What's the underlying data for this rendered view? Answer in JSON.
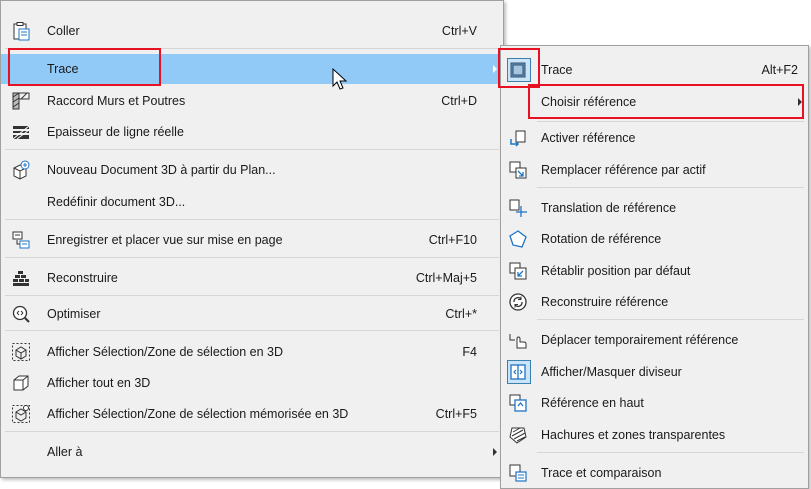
{
  "main_menu": {
    "items": [
      {
        "label": "Coller",
        "shortcut": "Ctrl+V",
        "icon": "clipboard-paste-icon"
      },
      {
        "label": "Trace",
        "shortcut": "",
        "icon": "",
        "submenu": true,
        "highlighted": true
      },
      {
        "label": "Raccord Murs et Poutres",
        "shortcut": "Ctrl+D",
        "icon": "wall-beam-join-icon"
      },
      {
        "label": "Epaisseur de ligne réelle",
        "shortcut": "",
        "icon": "line-weight-icon"
      },
      {
        "label": "Nouveau Document 3D à partir du Plan...",
        "shortcut": "",
        "icon": "new-3d-document-icon"
      },
      {
        "label": "Redéfinir document 3D...",
        "shortcut": "",
        "icon": ""
      },
      {
        "label": "Enregistrer et placer vue sur mise en page",
        "shortcut": "Ctrl+F10",
        "icon": "save-place-view-icon"
      },
      {
        "label": "Reconstruire",
        "shortcut": "Ctrl+Maj+5",
        "icon": "rebuild-icon"
      },
      {
        "label": "Optimiser",
        "shortcut": "Ctrl+*",
        "icon": "zoom-optimize-icon"
      },
      {
        "label": "Afficher Sélection/Zone de sélection en 3D",
        "shortcut": "F4",
        "icon": "selection-3d-icon"
      },
      {
        "label": "Afficher tout en 3D",
        "shortcut": "",
        "icon": "all-3d-icon"
      },
      {
        "label": "Afficher Sélection/Zone de sélection mémorisée en 3D",
        "shortcut": "Ctrl+F5",
        "icon": "stored-selection-3d-icon"
      },
      {
        "label": "Aller à",
        "shortcut": "",
        "icon": "",
        "submenu": true
      }
    ]
  },
  "sub_menu": {
    "items": [
      {
        "label": "Trace",
        "shortcut": "Alt+F2",
        "icon": "trace-toggle-icon",
        "checked": true
      },
      {
        "label": "Choisir référence",
        "shortcut": "",
        "icon": "",
        "submenu": true
      },
      {
        "label": "Activer référence",
        "shortcut": "",
        "icon": "activate-reference-icon"
      },
      {
        "label": "Remplacer référence par actif",
        "shortcut": "",
        "icon": "replace-reference-icon"
      },
      {
        "label": "Translation de référence",
        "shortcut": "",
        "icon": "translate-reference-icon"
      },
      {
        "label": "Rotation de référence",
        "shortcut": "",
        "icon": "rotate-reference-icon"
      },
      {
        "label": "Rétablir position par défaut",
        "shortcut": "",
        "icon": "reset-position-icon"
      },
      {
        "label": "Reconstruire référence",
        "shortcut": "",
        "icon": "rebuild-reference-icon"
      },
      {
        "label": "Déplacer temporairement référence",
        "shortcut": "",
        "icon": "temp-move-reference-icon"
      },
      {
        "label": "Afficher/Masquer diviseur",
        "shortcut": "",
        "icon": "divider-toggle-icon",
        "checked": true
      },
      {
        "label": "Référence en haut",
        "shortcut": "",
        "icon": "reference-on-top-icon"
      },
      {
        "label": "Hachures et zones transparentes",
        "shortcut": "",
        "icon": "hatch-transparent-icon"
      },
      {
        "label": "Trace et comparaison",
        "shortcut": "",
        "icon": "trace-compare-icon"
      }
    ]
  },
  "colors": {
    "highlight": "#91c9f7",
    "annotation_red": "#e81123",
    "icon_blue": "#1f74c6"
  }
}
